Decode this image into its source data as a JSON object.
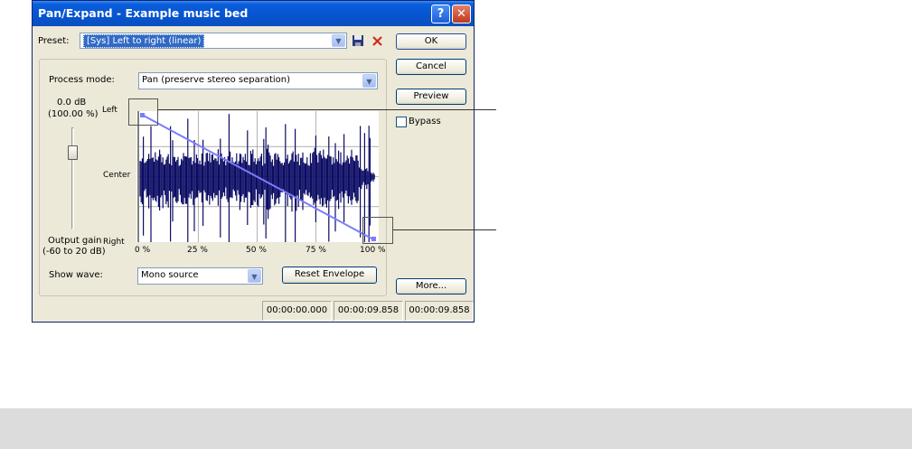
{
  "window": {
    "title": "Pan/Expand - Example music bed",
    "help_glyph": "?",
    "close_glyph": "✕"
  },
  "preset": {
    "label": "Preset:",
    "value": "[Sys] Left to right (linear)",
    "save_icon": "floppy-disk-icon",
    "delete_icon": "delete-x-icon"
  },
  "buttons": {
    "ok": "OK",
    "cancel": "Cancel",
    "preview": "Preview",
    "more": "More...",
    "reset_envelope": "Reset Envelope"
  },
  "bypass": {
    "label": "Bypass",
    "checked": false
  },
  "process_mode": {
    "label": "Process mode:",
    "value": "Pan (preserve stereo separation)"
  },
  "gain": {
    "value_db": "0.0 dB",
    "value_pct": "(100.00 %)",
    "caption_line1": "Output gain",
    "caption_line2": "(-60 to 20 dB)",
    "level_fraction": 0.75
  },
  "graph": {
    "y_labels": {
      "left": "Left",
      "center": "Center",
      "right": "Right"
    },
    "x_labels": [
      "0 %",
      "25 %",
      "50 %",
      "75 %",
      "100 %"
    ],
    "envelope_color": "#7b7bff",
    "wave_color": "#0c0c64",
    "envelope": {
      "start": 0,
      "end": 100
    }
  },
  "show_wave": {
    "label": "Show wave:",
    "value": "Mono source"
  },
  "status": {
    "start": "00:00:00.000",
    "end": "00:00:09.858",
    "length": "00:00:09.858"
  }
}
